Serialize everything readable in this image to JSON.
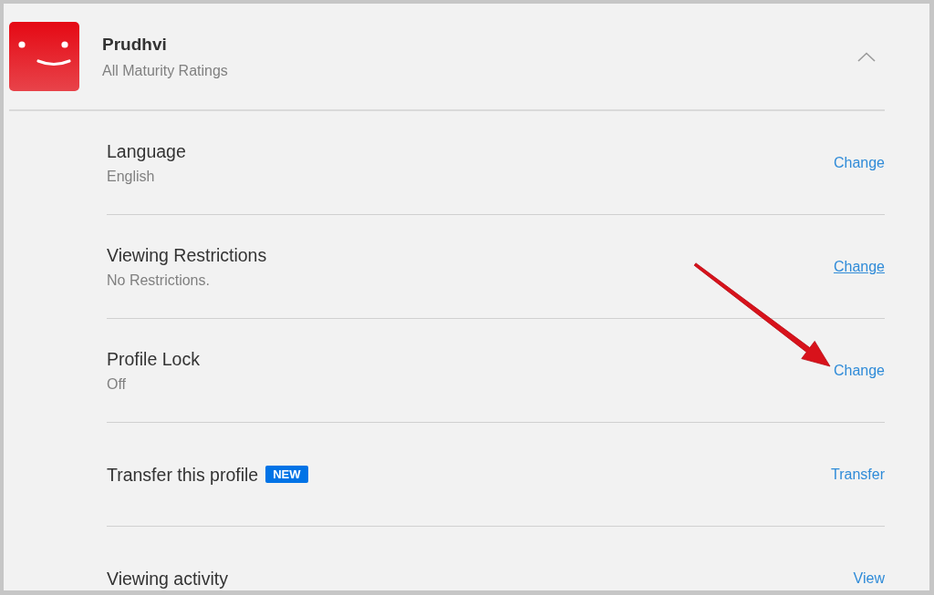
{
  "profile": {
    "name": "Prudhvi",
    "rating": "All Maturity Ratings",
    "expanded": true
  },
  "rows": [
    {
      "title": "Language",
      "value": "English",
      "action": {
        "label": "Change",
        "hovered": false
      }
    },
    {
      "title": "Viewing Restrictions",
      "value": "No Restrictions.",
      "action": {
        "label": "Change",
        "hovered": true
      }
    },
    {
      "title": "Profile Lock",
      "value": "Off",
      "action": {
        "label": "Change",
        "hovered": false
      }
    },
    {
      "title": "Transfer this profile",
      "badge": "NEW",
      "action": {
        "label": "Transfer",
        "hovered": false
      }
    },
    {
      "title": "Viewing activity",
      "action": {
        "label": "View",
        "hovered": false
      }
    }
  ]
}
